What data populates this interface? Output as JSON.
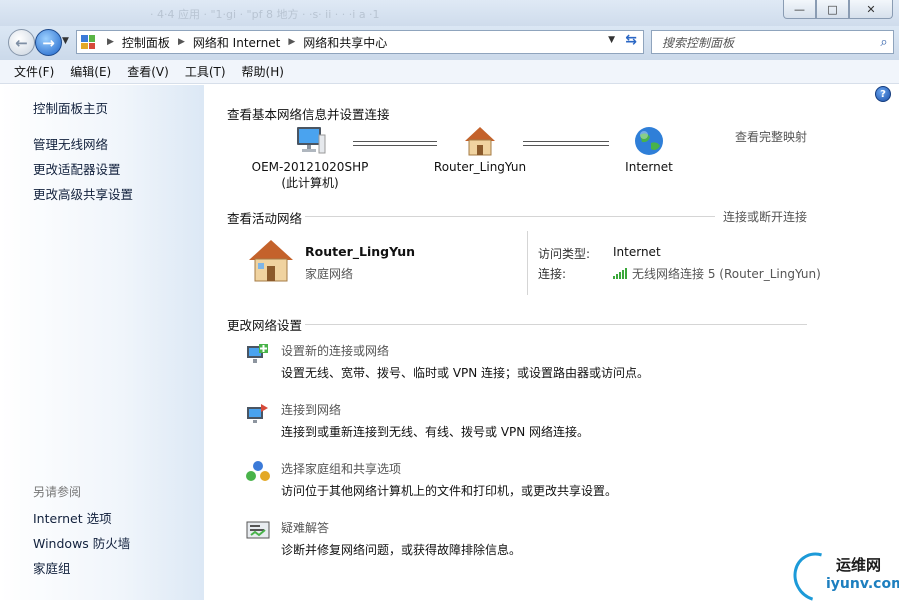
{
  "window": {
    "blurred_title": "  · 4·4       应用 · \"1·gi ·  \"pf 8 地方 · ·s· ii · ·  ·i         a ·1",
    "controls": {
      "minimize": "—",
      "maximize": "□",
      "close": "✕"
    }
  },
  "nav": {
    "back_glyph": "←",
    "forward_glyph": "→",
    "breadcrumbs": [
      "控制面板",
      "网络和 Internet",
      "网络和共享中心"
    ],
    "search_placeholder": "搜索控制面板"
  },
  "menu": [
    "文件(F)",
    "编辑(E)",
    "查看(V)",
    "工具(T)",
    "帮助(H)"
  ],
  "sidebar": {
    "home": "控制面板主页",
    "links": [
      "管理无线网络",
      "更改适配器设置",
      "更改高级共享设置"
    ],
    "see_also_heading": "另请参阅",
    "see_also": [
      "Internet 选项",
      "Windows 防火墙",
      "家庭组"
    ]
  },
  "main": {
    "help_glyph": "?",
    "heading": "查看基本网络信息并设置连接",
    "full_map_link": "查看完整映射",
    "map_nodes": [
      {
        "label": "OEM-20121020SHP",
        "sub": "(此计算机)",
        "icon": "computer-icon"
      },
      {
        "label": "Router_LingYun",
        "sub": "",
        "icon": "house-icon"
      },
      {
        "label": "Internet",
        "sub": "",
        "icon": "globe-icon"
      }
    ],
    "active_heading": "查看活动网络",
    "connect_link": "连接或断开连接",
    "active_network": {
      "name": "Router_LingYun",
      "type": "家庭网络",
      "access_label": "访问类型:",
      "access_value": "Internet",
      "conn_label": "连接:",
      "conn_value": "无线网络连接 5 (Router_LingYun)"
    },
    "change_heading": "更改网络设置",
    "tasks": [
      {
        "title": "设置新的连接或网络",
        "desc": "设置无线、宽带、拨号、临时或 VPN 连接；或设置路由器或访问点。",
        "icon": "new-connection-icon"
      },
      {
        "title": "连接到网络",
        "desc": "连接到或重新连接到无线、有线、拨号或 VPN 网络连接。",
        "icon": "connect-network-icon"
      },
      {
        "title": "选择家庭组和共享选项",
        "desc": "访问位于其他网络计算机上的文件和打印机，或更改共享设置。",
        "icon": "homegroup-icon"
      },
      {
        "title": "疑难解答",
        "desc": "诊断并修复网络问题，或获得故障排除信息。",
        "icon": "troubleshoot-icon"
      }
    ]
  },
  "watermark": {
    "top": "运维网",
    "bottom": "iyunv.com"
  },
  "colors": {
    "sidebar_grad_end": "#dce8f5",
    "link_text": "#12213d",
    "signal_green": "#3aa83a"
  }
}
